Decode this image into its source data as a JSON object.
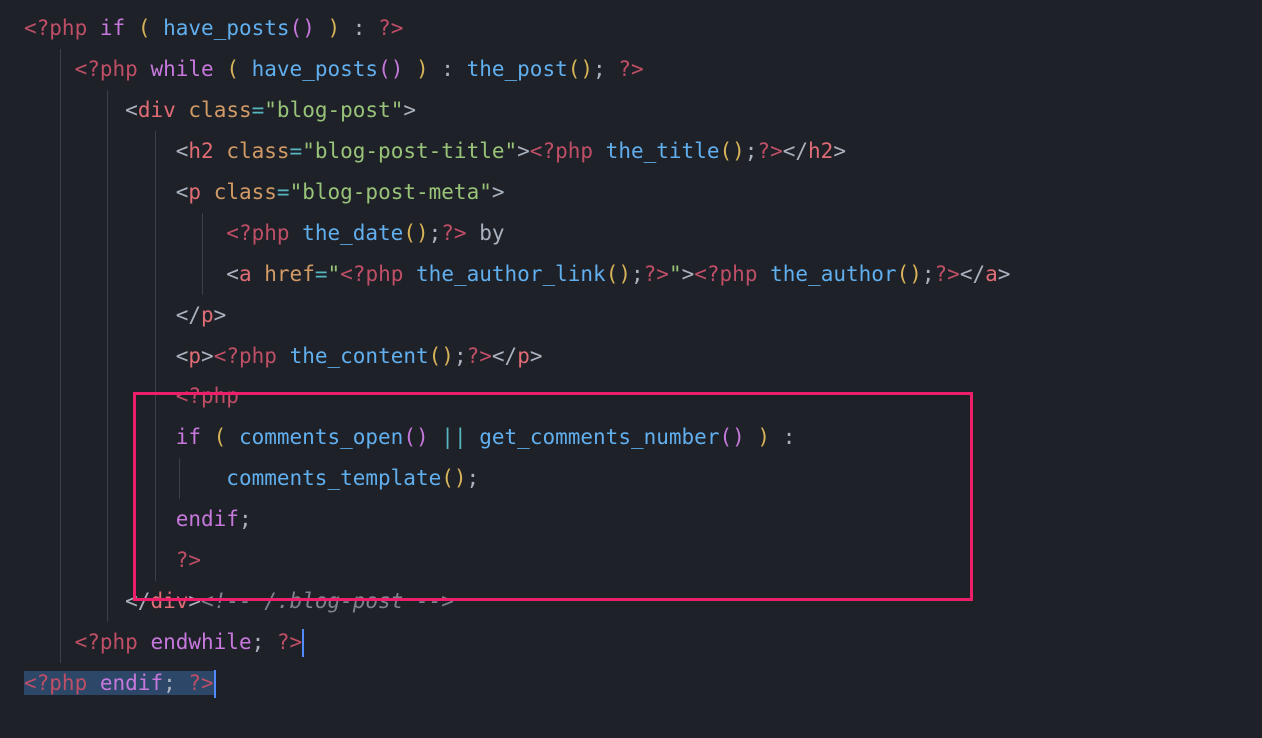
{
  "language": "php",
  "highlight_color": "#ed1f6a",
  "lines": {
    "l1_open": "<?php",
    "l1_if": "if",
    "l1_fn": "have_posts",
    "l1_close": "?>",
    "l2_open": "<?php",
    "l2_while": "while",
    "l2_fn1": "have_posts",
    "l2_fn2": "the_post",
    "l2_close": "?>",
    "l3_tag": "div",
    "l3_attr": "class",
    "l3_val": "\"blog-post\"",
    "l4_tag": "h2",
    "l4_attr": "class",
    "l4_val": "\"blog-post-title\"",
    "l4_open": "<?php",
    "l4_fn": "the_title",
    "l4_close": "?>",
    "l5_tag": "p",
    "l5_attr": "class",
    "l5_val": "\"blog-post-meta\"",
    "l6_open": "<?php",
    "l6_fn": "the_date",
    "l6_close": "?>",
    "l6_by": " by",
    "l7_tag": "a",
    "l7_attr": "href",
    "l7_open1": "<?php",
    "l7_fn1": "the_author_link",
    "l7_close1": "?>",
    "l7_open2": "<?php",
    "l7_fn2": "the_author",
    "l7_close2": "?>",
    "l8_tag": "p",
    "l9_tag": "p",
    "l9_open": "<?php",
    "l9_fn": "the_content",
    "l9_close": "?>",
    "l10_open": "<?php",
    "l11_if": "if",
    "l11_fn1": "comments_open",
    "l11_op": "||",
    "l11_fn2": "get_comments_number",
    "l12_fn": "comments_template",
    "l13_endif": "endif",
    "l14_close": "?>",
    "l15_tag": "div",
    "l15_comment": "<!-- /.blog-post -->",
    "l16_open": "<?php",
    "l16_kw": "endwhile",
    "l16_close": "?>",
    "l17_open": "<?php",
    "l17_kw": "endif",
    "l17_close": "?>"
  }
}
